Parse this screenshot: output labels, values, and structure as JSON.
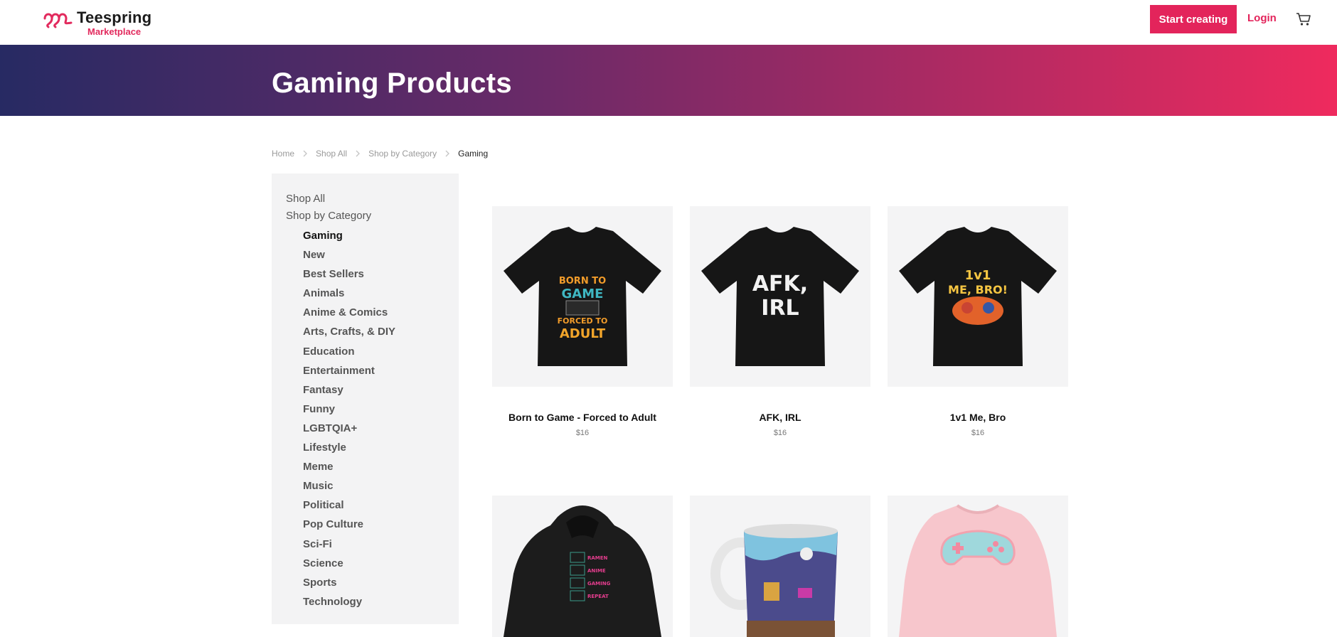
{
  "header": {
    "logo_name": "Teespring",
    "logo_sub": "Marketplace",
    "start_label": "Start creating",
    "login_label": "Login",
    "brand_color": "#e3245b"
  },
  "banner": {
    "title": "Gaming Products",
    "gradient_from": "#272a63",
    "gradient_to": "#ef2a5e"
  },
  "breadcrumb": [
    "Home",
    "Shop All",
    "Shop by Category",
    "Gaming"
  ],
  "sidebar": {
    "shop_all": "Shop All",
    "shop_by_category": "Shop by Category",
    "items": [
      "Gaming",
      "New",
      "Best Sellers",
      "Animals",
      "Anime & Comics",
      "Arts, Crafts, & DIY",
      "Education",
      "Entertainment",
      "Fantasy",
      "Funny",
      "LGBTQIA+",
      "Lifestyle",
      "Meme",
      "Music",
      "Political",
      "Pop Culture",
      "Sci-Fi",
      "Science",
      "Sports",
      "Technology"
    ],
    "active": "Gaming"
  },
  "products": [
    {
      "title": "Born to Game - Forced to Adult",
      "price": "$16",
      "image": "black-tshirt",
      "art": [
        "BORN TO",
        "GAME",
        "FORCED TO",
        "ADULT"
      ]
    },
    {
      "title": "AFK, IRL",
      "price": "$16",
      "image": "black-tshirt",
      "art": [
        "AFK,",
        "IRL"
      ]
    },
    {
      "title": "1v1 Me, Bro",
      "price": "$16",
      "image": "black-tshirt",
      "art": [
        "1v1",
        "ME, BRO!"
      ]
    },
    {
      "title": "",
      "price": "",
      "image": "black-hoodie",
      "art": [
        "RAMEN",
        "ANIME",
        "GAMING",
        "REPEAT"
      ]
    },
    {
      "title": "",
      "price": "",
      "image": "mug"
    },
    {
      "title": "",
      "price": "",
      "image": "pink-sweatshirt"
    }
  ]
}
